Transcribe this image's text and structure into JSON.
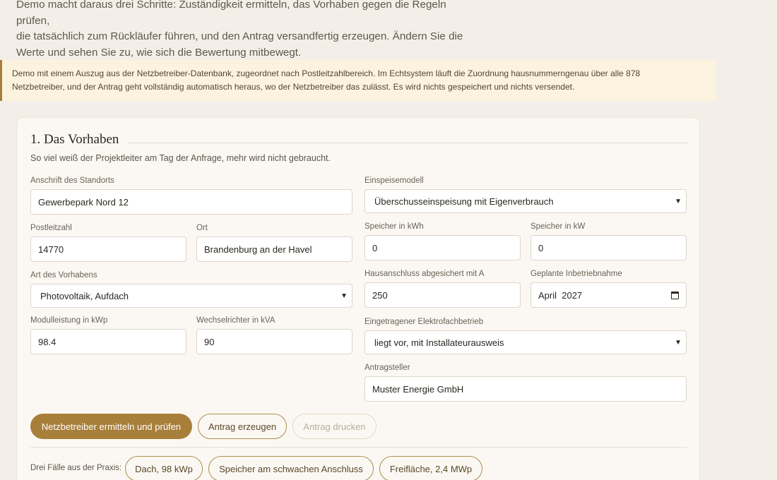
{
  "intro": {
    "line1": "Demo macht daraus drei Schritte: Zuständigkeit ermitteln, das Vorhaben gegen die Regeln prüfen,",
    "line2": "die tatsächlich zum Rückläufer führen, und den Antrag versandfertig erzeugen. Ändern Sie die",
    "line3": "Werte und sehen Sie zu, wie sich die Bewertung mitbewegt."
  },
  "notice": {
    "line1": "Demo mit einem Auszug aus der Netzbetreiber-Datenbank, zugeordnet nach Postleitzahlbereich. Im Echtsystem läuft die Zuordnung hausnummerngenau über alle 878",
    "line2": "Netzbetreiber, und der Antrag geht vollständig automatisch heraus, wo der Netzbetreiber das zulässt. Es wird nichts gespeichert und nichts versendet."
  },
  "section": {
    "title": "1. Das Vorhaben",
    "subtitle": "So viel weiß der Projektleiter am Tag der Anfrage, mehr wird nicht gebraucht."
  },
  "form": {
    "address": {
      "label": "Anschrift des Standorts",
      "value": "Gewerbepark Nord 12"
    },
    "zip": {
      "label": "Postleitzahl",
      "value": "14770"
    },
    "city": {
      "label": "Ort",
      "value": "Brandenburg an der Havel"
    },
    "project_type": {
      "label": "Art des Vorhabens",
      "value": "Photovoltaik, Aufdach"
    },
    "module_power": {
      "label": "Modulleistung in kWp",
      "value": "98.4"
    },
    "inverter": {
      "label": "Wechselrichter in kVA",
      "value": "90"
    },
    "feed_model": {
      "label": "Einspeisemodell",
      "value": "Überschusseinspeisung mit Eigenverbrauch"
    },
    "storage_kwh": {
      "label": "Speicher in kWh",
      "value": "0"
    },
    "storage_kw": {
      "label": "Speicher in kW",
      "value": "0"
    },
    "fuse": {
      "label": "Hausanschluss abgesichert mit A",
      "value": "250"
    },
    "commissioning": {
      "label": "Geplante Inbetriebnahme",
      "value": "April  2027"
    },
    "electrician": {
      "label": "Eingetragener Elektrofachbetrieb",
      "value": "liegt vor, mit Installateurausweis"
    },
    "applicant": {
      "label": "Antragsteller",
      "value": "Muster Energie GmbH"
    }
  },
  "actions": {
    "check": "Netzbetreiber ermitteln und prüfen",
    "generate": "Antrag erzeugen",
    "print": "Antrag drucken"
  },
  "cases": {
    "label": "Drei Fälle aus der Praxis:",
    "items": [
      "Dach, 98 kWp",
      "Speicher am schwachen Anschluss",
      "Freifläche, 2,4 MWp"
    ]
  },
  "colors": {
    "accent": "#a87f3a",
    "background": "#f3efe8",
    "notice": "#fcf3df"
  }
}
